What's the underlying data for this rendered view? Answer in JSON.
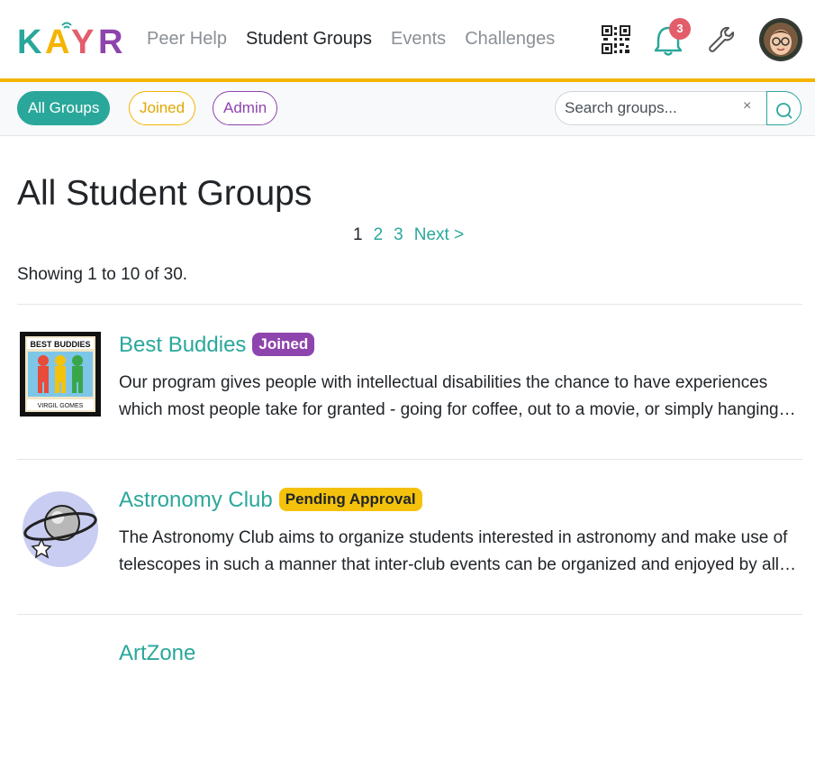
{
  "brand": {
    "logo_text": "KAYR",
    "accent": "#2aa79b",
    "highlight": "#f4b400",
    "purple": "#8e44ad"
  },
  "nav": {
    "links": [
      {
        "label": "Peer Help"
      },
      {
        "label": "Student Groups",
        "active": true
      },
      {
        "label": "Events"
      },
      {
        "label": "Challenges"
      }
    ],
    "notification_count": "3",
    "icons": [
      "qr-code-icon",
      "bell-icon",
      "wrench-icon",
      "avatar"
    ]
  },
  "filters": {
    "all": "All Groups",
    "joined": "Joined",
    "admin": "Admin",
    "search_placeholder": "Search groups...",
    "clear": "×"
  },
  "page": {
    "title": "All Student Groups",
    "pagination": [
      "1",
      "2",
      "3",
      "Next >"
    ],
    "current_page": "1",
    "showing": "Showing 1 to 10 of 30."
  },
  "groups": [
    {
      "name": "Best Buddies",
      "badge": "Joined",
      "description": "Our program gives people with intellectual disabilities the chance to have experiences which most people take for granted - going for coffee, out to a movie, or simply hanging out with friends."
    },
    {
      "name": "Astronomy Club",
      "badge": "Pending Approval",
      "description": "The Astronomy Club aims to organize students interested in astronomy and make use of telescopes in such a manner that inter-club events can be organized and enjoyed by all members."
    },
    {
      "name": "ArtZone",
      "badge": "",
      "description": ""
    }
  ]
}
